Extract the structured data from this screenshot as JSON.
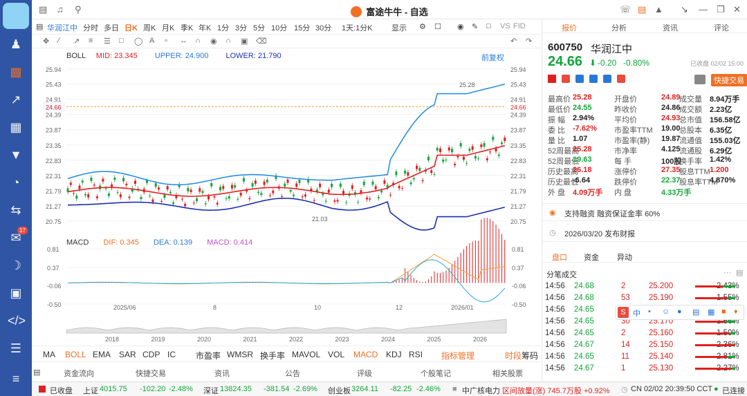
{
  "app": {
    "title": "富途牛牛 - 自选"
  },
  "toolbar": {
    "stock_name": "华润江中",
    "periods": [
      "分时",
      "多日",
      "日K",
      "周K",
      "月K",
      "季K",
      "年K",
      "1分",
      "3分",
      "5分",
      "10分",
      "15分",
      "30分",
      "1天:1分K",
      "显示"
    ],
    "active_period": "日K"
  },
  "indicator_bar": {
    "boll": "BOLL",
    "mid": "MID: 23.345",
    "upper": "UPPER: 24.900",
    "lower": "LOWER: 21.790",
    "fq": "前复权"
  },
  "macd_bar": {
    "name": "MACD",
    "dif": "DIF: 0.345",
    "dea": "DEA: 0.139",
    "macd": "MACD: 0.414"
  },
  "chart_data": {
    "type": "candlestick",
    "y_ticks": [
      "25.94",
      "25.43",
      "24.91",
      "24.39",
      "23.87",
      "23.35",
      "22.83",
      "22.31",
      "21.79",
      "21.27",
      "20.75"
    ],
    "current_price": "24.66",
    "high_label": "25.28",
    "low_label": "21.03",
    "x_labels": [
      "2025/06",
      "8",
      "10",
      "12",
      "2026/01"
    ],
    "macd_ticks": [
      "0.81",
      "0.37",
      "-0.06",
      "-0.50"
    ],
    "overview_years": [
      "2018",
      "2019",
      "2020",
      "2021",
      "2022",
      "2023",
      "2024",
      "2025",
      "2026"
    ],
    "series": [
      {
        "name": "UPPER",
        "color": "#2a8fe0"
      },
      {
        "name": "MID",
        "color": "#e02020"
      },
      {
        "name": "LOWER",
        "color": "#1b2fb3"
      }
    ],
    "ylim": [
      20.75,
      25.94
    ]
  },
  "indicator_tabs": [
    "MA",
    "BOLL",
    "EMA",
    "SAR",
    "CDP",
    "IC",
    "市盈率",
    "WMSR",
    "换手率",
    "MAVOL",
    "VOL",
    "MACD",
    "KDJ",
    "RSI",
    "指标管理",
    "时段",
    "筹码"
  ],
  "bottom_tabs": [
    "资金流向",
    "快捷交易",
    "资讯",
    "公告",
    "评级",
    "个股笔记",
    "相关股票"
  ],
  "right": {
    "tabs": [
      "报价",
      "分析",
      "资讯",
      "评论"
    ],
    "code": "600750",
    "name": "华润江中",
    "close_note": "已收盘 02/02 15:00",
    "price": "24.66",
    "change": "-0.20",
    "pct": "-0.80%",
    "trade_btn": "快捷交易",
    "quotes": [
      [
        "最高价",
        "25.28",
        "开盘价",
        "24.89",
        "成交量",
        "8.94万手"
      ],
      [
        "最低价",
        "24.55",
        "昨收价",
        "24.86",
        "成交额",
        "2.23亿"
      ],
      [
        "振 幅",
        "2.94%",
        "平均价",
        "24.93",
        "总市值",
        "156.58亿"
      ],
      [
        "委 比",
        "-7.62%",
        "市盈率TTM",
        "19.00",
        "总股本",
        "6.35亿"
      ],
      [
        "量 比",
        "1.07",
        "市盈率(静)",
        "19.87",
        "流通值",
        "155.03亿"
      ],
      [
        "52周最高",
        "25.28",
        "市净率",
        "4.125",
        "流通股",
        "6.29亿"
      ],
      [
        "52周最低",
        "19.63",
        "每 手",
        "100股",
        "换手率",
        "1.42%"
      ],
      [
        "历史最高",
        "26.18",
        "涨停价",
        "27.35",
        "股息TTM",
        "1.200"
      ],
      [
        "历史最低",
        "-6.64",
        "跌停价",
        "22.37",
        "股息率TTM",
        "4.870%"
      ],
      [
        "外 盘",
        "4.09万手",
        "内 盘",
        "4.33万手",
        "",
        ""
      ]
    ],
    "notice1": "支持融资 融资保证金率 60%",
    "notice2": "2026/03/20 发布财报",
    "sub_tabs": [
      "盘口",
      "资金",
      "异动"
    ],
    "trades_title": "分笔成交",
    "trades": [
      [
        "14:56",
        "24.68",
        "2",
        "25.200",
        "2.43%"
      ],
      [
        "14:56",
        "24.68",
        "53",
        "25.190",
        "1.55%"
      ],
      [
        "14:56",
        "24.65",
        "",
        "",
        "1.03%"
      ],
      [
        "14:56",
        "24.65",
        "30",
        "25.170",
        "1.56%"
      ],
      [
        "14:56",
        "24.65",
        "2",
        "25.160",
        "1.50%"
      ],
      [
        "14:56",
        "24.67",
        "14",
        "25.150",
        "2.36%"
      ],
      [
        "14:56",
        "24.65",
        "11",
        "25.140",
        "2.81%"
      ],
      [
        "14:56",
        "24.67",
        "1",
        "25.130",
        "2.27%"
      ]
    ]
  },
  "status": {
    "closed": "已收盘",
    "sh": "上证",
    "sh_val": "4015.75",
    "sh_chg": "-102.20",
    "sh_pct": "-2.48%",
    "sz": "深证",
    "sz_val": "13824.35",
    "sz_chg": "-381.54",
    "sz_pct": "-2.69%",
    "cy": "创业板",
    "cy_val": "3264.11",
    "cy_chg": "-82.25",
    "cy_pct": "-2.46%",
    "news": "中广核电力",
    "news2": "区间放量(涨) 745.7万股 +0.92%",
    "time": "CN 02/02 20:39:50 CCT",
    "conn": "已连接"
  },
  "colors": {
    "accent": "#f26f21",
    "up": "#e02020",
    "down": "#13a538",
    "sidebar": "#2f55a4"
  }
}
